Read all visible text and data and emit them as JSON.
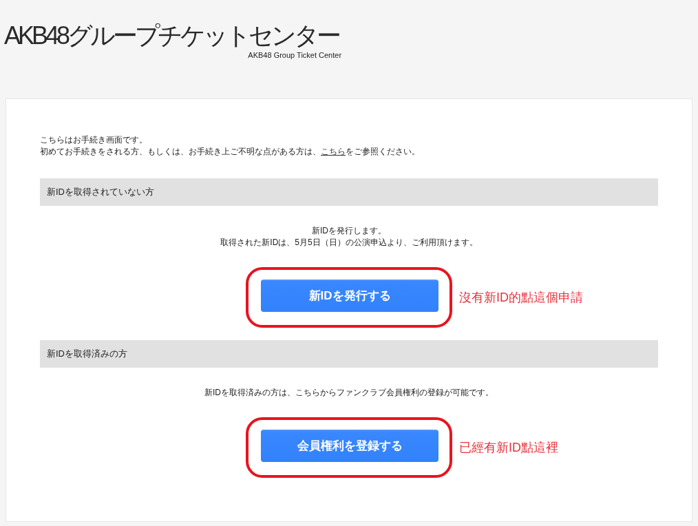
{
  "header": {
    "logo": "AKB48グループチケットセンター",
    "subtitle": "AKB48 Group Ticket Center"
  },
  "intro": {
    "line_1": "こちらはお手続き画面です。",
    "line_2": {
      "before": "初めてお手続きをされる方、もしくは、お手続き上ご不明な点がある方は、",
      "link": "こちら",
      "after": "をご参照ください。"
    }
  },
  "sections": [
    {
      "heading": "新IDを取得されていない方",
      "description": [
        "新IDを発行します。",
        "取得された新IDは、5月5日（日）の公演申込より、ご利用頂けます。"
      ],
      "button": "新IDを発行する",
      "circled": true,
      "note": "沒有新ID的點這個申請"
    },
    {
      "heading": "新IDを取得済みの方",
      "description": [
        "新IDを取得済みの方は、こちらからファンクラブ会員権利の登録が可能です。"
      ],
      "button": "会員権利を登録する",
      "circled": true,
      "note": "已經有新ID點這裡"
    }
  ]
}
